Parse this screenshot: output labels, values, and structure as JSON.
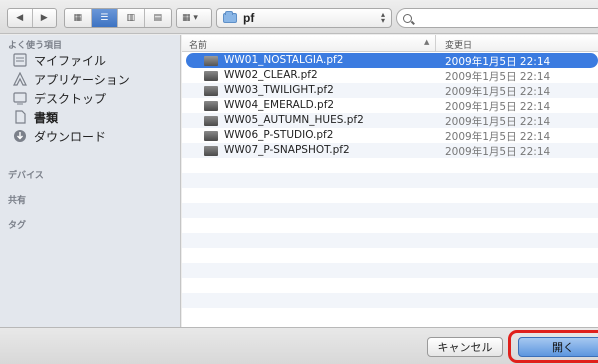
{
  "toolbar": {
    "back_icon": "back-arrow-icon",
    "forward_icon": "forward-arrow-icon",
    "view_modes": [
      "icon-view",
      "list-view",
      "column-view",
      "coverflow-view"
    ],
    "active_view": "list-view",
    "arrange_icon": "arrange-grid-icon",
    "path": "pf",
    "search_placeholder": ""
  },
  "sidebar": {
    "sections": [
      {
        "title": "よく使う項目",
        "items": [
          {
            "label": "マイファイル",
            "icon": "my-files-icon"
          },
          {
            "label": "アプリケーション",
            "icon": "applications-icon"
          },
          {
            "label": "デスクトップ",
            "icon": "desktop-icon"
          },
          {
            "label": "書類",
            "icon": "documents-icon"
          },
          {
            "label": "ダウンロード",
            "icon": "downloads-icon"
          }
        ]
      },
      {
        "title": "デバイス",
        "items": []
      },
      {
        "title": "共有",
        "items": []
      },
      {
        "title": "タグ",
        "items": []
      }
    ]
  },
  "list": {
    "columns": {
      "name": "名前",
      "date": "変更日",
      "sort_indicator": "▲"
    },
    "rows": [
      {
        "name": "WW01_NOSTALGIA.pf2",
        "date": "2009年1月5日 22:14",
        "selected": true
      },
      {
        "name": "WW02_CLEAR.pf2",
        "date": "2009年1月5日 22:14",
        "selected": false
      },
      {
        "name": "WW03_TWILIGHT.pf2",
        "date": "2009年1月5日 22:14",
        "selected": false
      },
      {
        "name": "WW04_EMERALD.pf2",
        "date": "2009年1月5日 22:14",
        "selected": false
      },
      {
        "name": "WW05_AUTUMN_HUES.pf2",
        "date": "2009年1月5日 22:14",
        "selected": false
      },
      {
        "name": "WW06_P-STUDIO.pf2",
        "date": "2009年1月5日 22:14",
        "selected": false
      },
      {
        "name": "WW07_P-SNAPSHOT.pf2",
        "date": "2009年1月5日 22:14",
        "selected": false
      }
    ]
  },
  "buttons": {
    "cancel": "キャンセル",
    "open": "開く"
  },
  "colors": {
    "selection": "#3b7be0",
    "highlight_annotation": "#e0201b"
  }
}
